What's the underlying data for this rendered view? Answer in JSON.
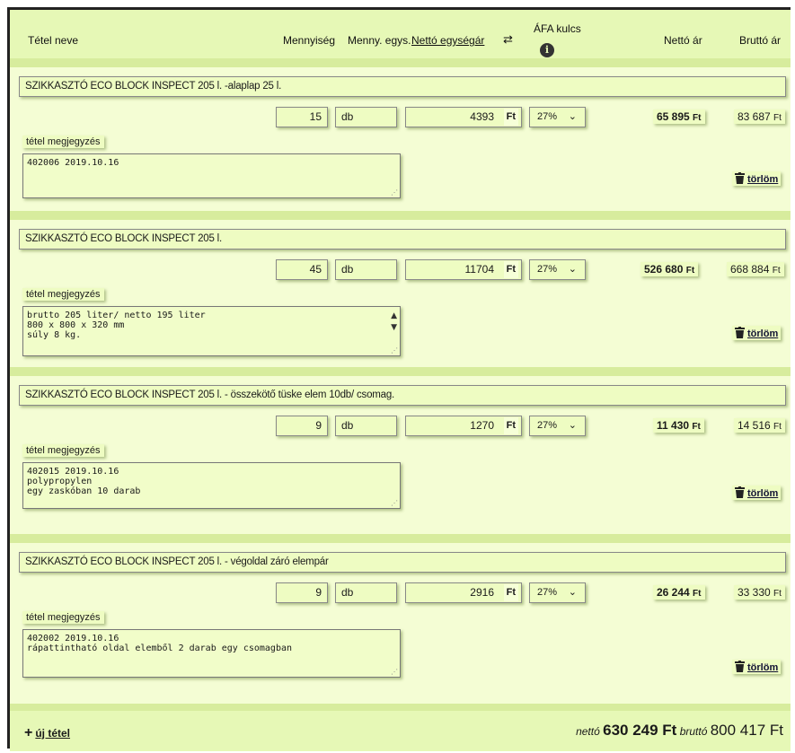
{
  "header": {
    "item_name": "Tétel neve",
    "quantity": "Mennyiség",
    "unit": "Menny. egys.",
    "unit_price": "Nettó egységár",
    "swap_icon": "⇄",
    "vat": "ÁFA kulcs",
    "info_icon": "i",
    "net": "Nettó ár",
    "gross": "Bruttó ár"
  },
  "currency": "Ft",
  "note_label": "tétel megjegyzés",
  "delete_label": "törlöm",
  "items": [
    {
      "name": "SZIKKASZTÓ ECO BLOCK INSPECT 205 l. -alaplap 25 l.",
      "qty": "15",
      "unit": "db",
      "unit_price": "4393",
      "vat": "27%",
      "net": "65 895",
      "gross": "83 687",
      "note": "402006 2019.10.16"
    },
    {
      "name": "SZIKKASZTÓ ECO BLOCK INSPECT 205 l.",
      "qty": "45",
      "unit": "db",
      "unit_price": "11704",
      "vat": "27%",
      "net": "526 680",
      "gross": "668 884",
      "note": "brutto 205 liter/ netto 195 liter\n800 x 800 x 320 mm\nsúly 8 kg."
    },
    {
      "name": "SZIKKASZTÓ ECO BLOCK INSPECT 205 l. - összekötő tüske elem 10db/ csomag.",
      "qty": "9",
      "unit": "db",
      "unit_price": "1270",
      "vat": "27%",
      "net": "11 430",
      "gross": "14 516",
      "note": "402015 2019.10.16\npolypropylen\negy zaskóban 10 darab"
    },
    {
      "name": "SZIKKASZTÓ ECO BLOCK INSPECT 205 l. - végoldal záró elempár",
      "qty": "9",
      "unit": "db",
      "unit_price": "2916",
      "vat": "27%",
      "net": "26 244",
      "gross": "33 330",
      "note": "402002 2019.10.16\nrápattintható oldal elemből 2 darab egy csomagban"
    }
  ],
  "footer": {
    "add_label": "új tétel",
    "add_icon": "+",
    "net_label": "nettó",
    "net_total": "630 249 Ft",
    "gross_label": "bruttó",
    "gross_total": "800 417 Ft"
  }
}
